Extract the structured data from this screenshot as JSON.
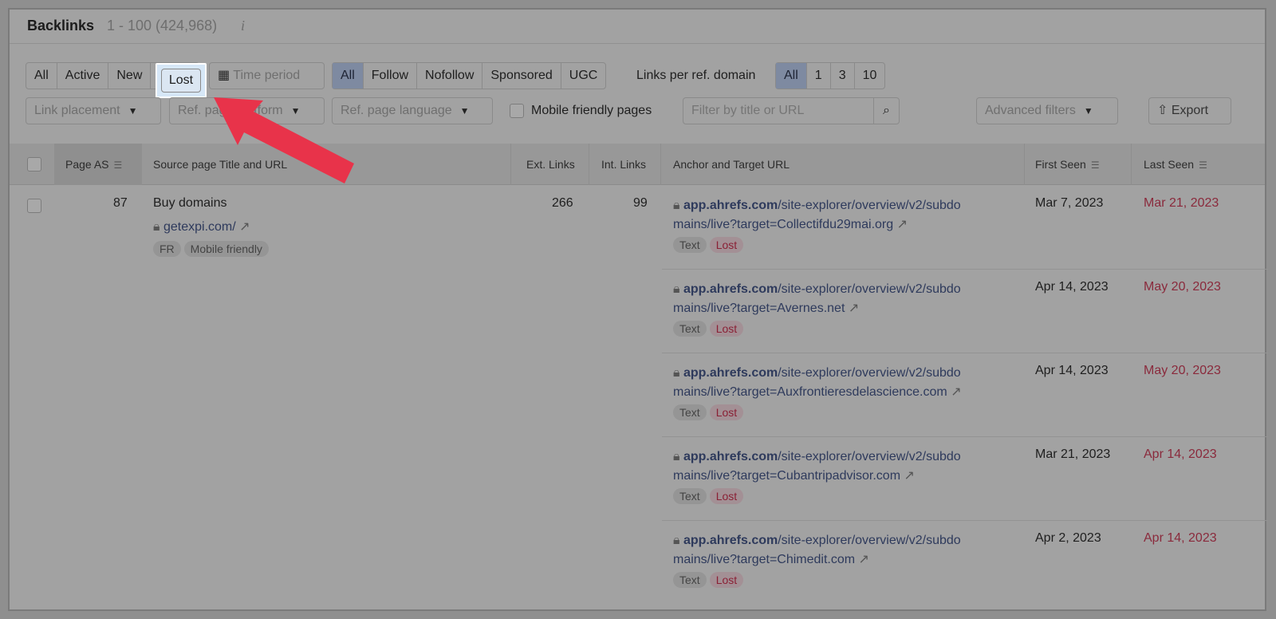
{
  "header": {
    "title": "Backlinks",
    "count": "1 - 100 (424,968)",
    "info_icon": "i"
  },
  "status_filter": [
    "All",
    "Active",
    "New",
    "Lost"
  ],
  "time_period": "Time period",
  "link_type": [
    "All",
    "Follow",
    "Nofollow",
    "Sponsored",
    "UGC"
  ],
  "links_per_domain": {
    "label": "Links per ref. domain",
    "options": [
      "All",
      "1",
      "3",
      "10"
    ]
  },
  "dropdowns": {
    "link_placement": "Link placement",
    "platform": "Ref. page platform",
    "language": "Ref. page language",
    "advanced": "Advanced filters"
  },
  "mobile_friendly": "Mobile friendly pages",
  "search": {
    "placeholder": "Filter by title or URL"
  },
  "export": "Export",
  "columns": {
    "page_as": "Page AS",
    "source": "Source page Title and URL",
    "ext": "Ext. Links",
    "int": "Int. Links",
    "anchor": "Anchor and Target URL",
    "first": "First Seen",
    "last": "Last Seen"
  },
  "source": {
    "page_as": "87",
    "title": "Buy domains",
    "url": "getexpi.com/",
    "tags": [
      "FR",
      "Mobile friendly"
    ],
    "ext": "266",
    "int": "99"
  },
  "rows": [
    {
      "domain": "app.ahrefs.com",
      "path1": "/site-explorer/overview/v2/subdo",
      "path2": "mains/live?target=Collectifdu29mai.org",
      "tag1": "Text",
      "tag2": "Lost",
      "first": "Mar 7, 2023",
      "last": "Mar 21, 2023"
    },
    {
      "domain": "app.ahrefs.com",
      "path1": "/site-explorer/overview/v2/subdo",
      "path2": "mains/live?target=Avernes.net",
      "tag1": "Text",
      "tag2": "Lost",
      "first": "Apr 14, 2023",
      "last": "May 20, 2023"
    },
    {
      "domain": "app.ahrefs.com",
      "path1": "/site-explorer/overview/v2/subdo",
      "path2": "mains/live?target=Auxfrontieresdelascience.com",
      "tag1": "Text",
      "tag2": "Lost",
      "first": "Apr 14, 2023",
      "last": "May 20, 2023"
    },
    {
      "domain": "app.ahrefs.com",
      "path1": "/site-explorer/overview/v2/subdo",
      "path2": "mains/live?target=Cubantripadvisor.com",
      "tag1": "Text",
      "tag2": "Lost",
      "first": "Mar 21, 2023",
      "last": "Apr 14, 2023"
    },
    {
      "domain": "app.ahrefs.com",
      "path1": "/site-explorer/overview/v2/subdo",
      "path2": "mains/live?target=Chimedit.com",
      "tag1": "Text",
      "tag2": "Lost",
      "first": "Apr 2, 2023",
      "last": "Apr 14, 2023"
    }
  ],
  "colors": {
    "arrow": "#e8334a",
    "lost": "#8a2035",
    "active_segment": "#7e8aa1"
  }
}
